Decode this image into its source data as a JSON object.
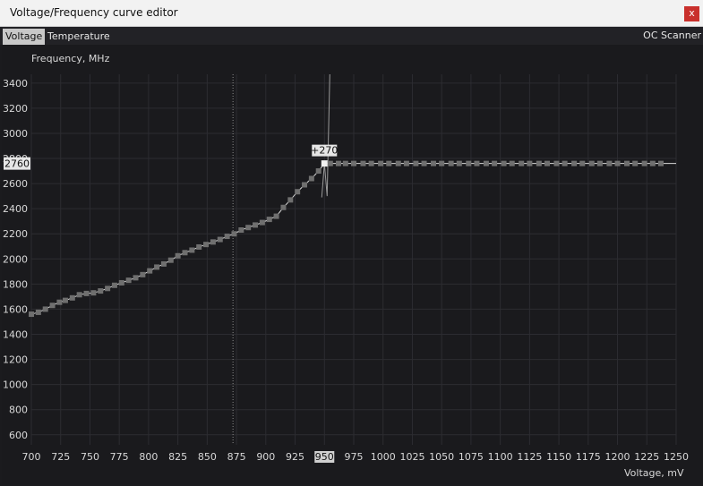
{
  "window": {
    "title": "Voltage/Frequency curve editor",
    "close_label": "x"
  },
  "tabs": [
    {
      "label": "Voltage",
      "active": true
    },
    {
      "label": "Temperature",
      "active": false
    }
  ],
  "oc_scanner_label": "OC Scanner",
  "chart_data": {
    "type": "line",
    "ylabel": "Frequency, MHz",
    "xlabel": "Voltage, mV",
    "xlim": [
      700,
      1250
    ],
    "ylim": [
      520,
      3470
    ],
    "x_ticks": [
      700,
      725,
      750,
      775,
      800,
      825,
      850,
      875,
      900,
      925,
      950,
      975,
      1000,
      1025,
      1050,
      1075,
      1100,
      1125,
      1150,
      1175,
      1200,
      1225,
      1250
    ],
    "y_ticks": [
      600,
      800,
      1000,
      1200,
      1400,
      1600,
      1800,
      2000,
      2200,
      2400,
      2600,
      2800,
      3000,
      3200,
      3400
    ],
    "highlight_x_label": "950",
    "highlight_y_label": "2760",
    "selected_point_label": "+270",
    "selected_point": {
      "x": 950,
      "y": 2760
    },
    "reference_line_x": 872,
    "grid": true,
    "series": [
      {
        "values": [
          [
            700,
            1560
          ],
          [
            706,
            1575
          ],
          [
            712,
            1600
          ],
          [
            718,
            1630
          ],
          [
            724,
            1655
          ],
          [
            729,
            1670
          ],
          [
            735,
            1690
          ],
          [
            741,
            1715
          ],
          [
            747,
            1725
          ],
          [
            753,
            1730
          ],
          [
            759,
            1745
          ],
          [
            765,
            1765
          ],
          [
            771,
            1790
          ],
          [
            777,
            1810
          ],
          [
            783,
            1830
          ],
          [
            789,
            1850
          ],
          [
            795,
            1875
          ],
          [
            801,
            1905
          ],
          [
            807,
            1935
          ],
          [
            813,
            1960
          ],
          [
            819,
            1990
          ],
          [
            825,
            2025
          ],
          [
            831,
            2050
          ],
          [
            837,
            2070
          ],
          [
            843,
            2095
          ],
          [
            849,
            2115
          ],
          [
            855,
            2135
          ],
          [
            861,
            2155
          ],
          [
            867,
            2180
          ],
          [
            873,
            2200
          ],
          [
            879,
            2230
          ],
          [
            885,
            2250
          ],
          [
            891,
            2270
          ],
          [
            897,
            2290
          ],
          [
            903,
            2315
          ],
          [
            909,
            2340
          ],
          [
            915,
            2410
          ],
          [
            921,
            2470
          ],
          [
            927,
            2535
          ],
          [
            933,
            2590
          ],
          [
            939,
            2640
          ],
          [
            945,
            2700
          ],
          [
            950,
            2760
          ],
          [
            955,
            2760
          ],
          [
            962,
            2760
          ],
          [
            968,
            2760
          ],
          [
            975,
            2760
          ],
          [
            983,
            2760
          ],
          [
            990,
            2760
          ],
          [
            998,
            2760
          ],
          [
            1005,
            2760
          ],
          [
            1013,
            2760
          ],
          [
            1020,
            2760
          ],
          [
            1028,
            2760
          ],
          [
            1035,
            2760
          ],
          [
            1043,
            2760
          ],
          [
            1050,
            2760
          ],
          [
            1058,
            2760
          ],
          [
            1065,
            2760
          ],
          [
            1073,
            2760
          ],
          [
            1080,
            2760
          ],
          [
            1088,
            2760
          ],
          [
            1095,
            2760
          ],
          [
            1103,
            2760
          ],
          [
            1110,
            2760
          ],
          [
            1118,
            2760
          ],
          [
            1125,
            2760
          ],
          [
            1133,
            2760
          ],
          [
            1140,
            2760
          ],
          [
            1148,
            2760
          ],
          [
            1155,
            2760
          ],
          [
            1163,
            2760
          ],
          [
            1170,
            2760
          ],
          [
            1178,
            2760
          ],
          [
            1185,
            2760
          ],
          [
            1193,
            2760
          ],
          [
            1200,
            2760
          ],
          [
            1208,
            2760
          ],
          [
            1215,
            2760
          ],
          [
            1223,
            2760
          ],
          [
            1230,
            2760
          ],
          [
            1237,
            2760
          ],
          [
            1250,
            2760
          ]
        ]
      }
    ],
    "colors": {
      "background": "#1b1b1e",
      "grid": "#2c2c31",
      "curve": "#d8d8d8",
      "points": "#6f6f6f",
      "selected_point": "#f2f2f2",
      "text": "#d8d8d8"
    }
  }
}
